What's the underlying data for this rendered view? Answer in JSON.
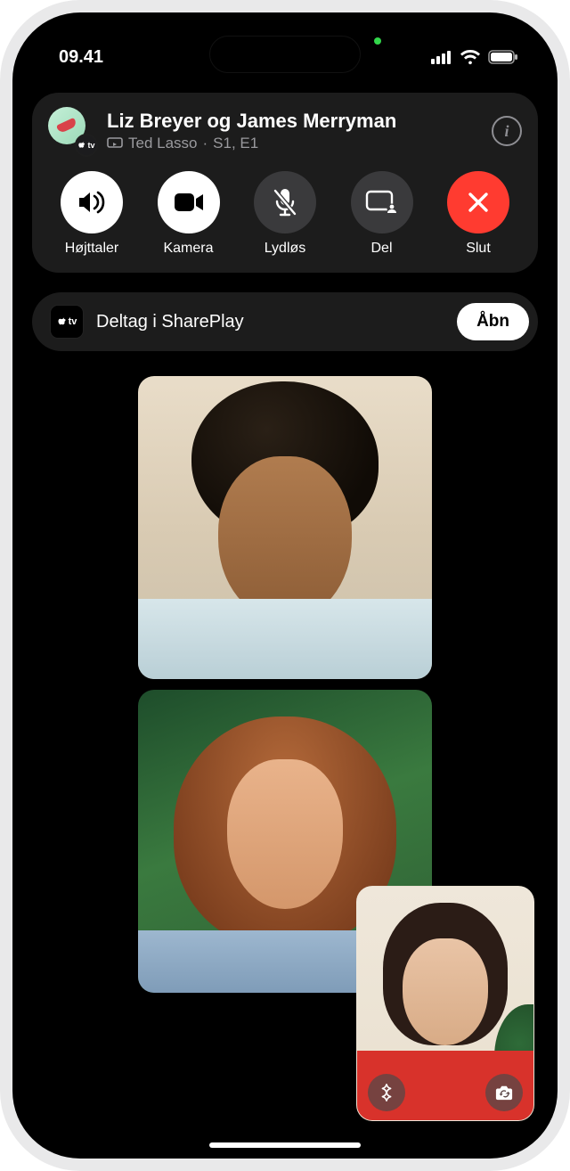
{
  "status": {
    "time": "09.41"
  },
  "call": {
    "title": "Liz Breyer og James Merryman",
    "subtitle_show": "Ted Lasso",
    "subtitle_episode": "S1, E1",
    "subtitle_sep": "·"
  },
  "controls": {
    "speaker": "Højttaler",
    "camera": "Kamera",
    "mute": "Lydløs",
    "share": "Del",
    "end": "Slut"
  },
  "shareplay": {
    "app": "tv",
    "label": "Deltag i SharePlay",
    "open": "Åbn"
  },
  "appletv_badge": "tv"
}
